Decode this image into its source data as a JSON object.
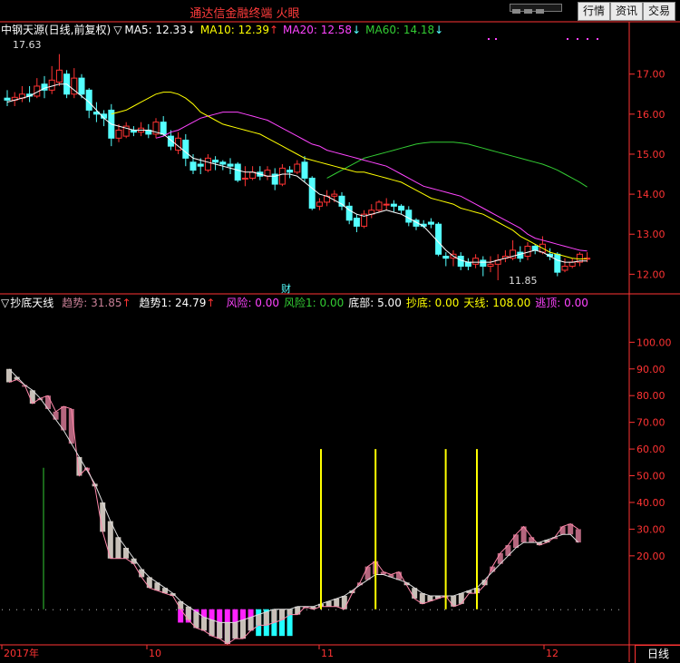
{
  "window": {
    "title": "通达信金融终端 火眼",
    "buttons": [
      {
        "name": "quote-button",
        "label": "行情"
      },
      {
        "name": "info-button",
        "label": "资讯"
      },
      {
        "name": "trade-button",
        "label": "交易"
      }
    ]
  },
  "price_legend": {
    "stock": "中钢天源(日线,前复权)",
    "toggle": "▽",
    "ma5": "MA5: 12.33",
    "ma5_arrow": "↓",
    "ma10": "MA10: 12.39",
    "ma10_arrow": "↑",
    "ma20": "MA20: 12.58",
    "ma20_arrow": "↓",
    "ma60": "MA60: 14.18",
    "ma60_arrow": "↓"
  },
  "indicator_legend": {
    "toggle": "▽",
    "name": "抄底天线",
    "trend": "趋势: 31.85",
    "trend_arrow": "↑",
    "trend1": "趋势1: 24.79",
    "trend1_arrow": "↑",
    "risk": "风险: 0.00",
    "risk1": "风险1: 0.00",
    "bottom": "底部: 5.00",
    "buy_bottom": "抄底: 0.00",
    "antenna": "天线: 108.00",
    "escape_top": "逃顶: 0.00"
  },
  "annotations": {
    "high": "17.63",
    "low": "11.85",
    "finance_marker": "财"
  },
  "period_label": "日线",
  "colors": {
    "up": "#ff3333",
    "down": "#54ffff",
    "ma5": "#ffffff",
    "ma10": "#ffff00",
    "ma20": "#ff44ff",
    "ma60": "#33cc33",
    "trend_up": "#b5667e",
    "trend_down": "#c8c0b8",
    "antenna": "#ffff00",
    "risk": "#ff22ff",
    "bottom_bar": "#22ffff"
  },
  "chart_data": [
    {
      "type": "candlestick",
      "name": "price",
      "y_ticks": [
        "17.00",
        "16.00",
        "15.00",
        "14.00",
        "13.00",
        "12.00"
      ],
      "ylim": [
        11.6,
        17.9
      ],
      "x_ticks": [
        "2017年",
        "10",
        "11",
        "12"
      ],
      "candles": [
        [
          16.4,
          16.35,
          16.6,
          16.2
        ],
        [
          16.35,
          16.42,
          16.55,
          16.2
        ],
        [
          16.4,
          16.5,
          16.7,
          16.3
        ],
        [
          16.5,
          16.45,
          16.7,
          16.3
        ],
        [
          16.45,
          16.7,
          16.9,
          16.4
        ],
        [
          16.75,
          16.6,
          16.95,
          16.4
        ],
        [
          16.6,
          16.85,
          17.2,
          16.5
        ],
        [
          16.8,
          17.1,
          17.5,
          16.7
        ],
        [
          17.0,
          16.5,
          17.1,
          16.4
        ],
        [
          16.5,
          16.9,
          17.15,
          16.4
        ],
        [
          16.9,
          16.5,
          17.0,
          16.4
        ],
        [
          16.6,
          16.1,
          16.65,
          15.9
        ],
        [
          16.05,
          16.0,
          16.3,
          15.8
        ],
        [
          16.0,
          15.9,
          16.1,
          15.7
        ],
        [
          16.1,
          15.4,
          16.25,
          15.2
        ],
        [
          15.4,
          15.6,
          15.75,
          15.3
        ],
        [
          15.45,
          15.7,
          15.8,
          15.4
        ],
        [
          15.6,
          15.55,
          15.7,
          15.45
        ],
        [
          15.55,
          15.65,
          15.8,
          15.45
        ],
        [
          15.6,
          15.5,
          15.75,
          15.4
        ],
        [
          15.5,
          15.8,
          15.9,
          15.4
        ],
        [
          15.8,
          15.5,
          15.95,
          15.45
        ],
        [
          15.45,
          15.2,
          15.6,
          15.1
        ],
        [
          15.1,
          15.4,
          15.55,
          15.0
        ],
        [
          15.35,
          14.9,
          15.5,
          14.7
        ],
        [
          14.8,
          14.6,
          15.0,
          14.5
        ],
        [
          14.75,
          14.7,
          14.9,
          14.5
        ],
        [
          14.6,
          14.9,
          15.0,
          14.55
        ],
        [
          14.85,
          14.8,
          14.95,
          14.6
        ],
        [
          14.8,
          14.75,
          14.85,
          14.6
        ],
        [
          14.75,
          14.7,
          14.9,
          14.5
        ],
        [
          14.75,
          14.35,
          14.8,
          14.3
        ],
        [
          14.4,
          14.4,
          14.7,
          14.2
        ],
        [
          14.4,
          14.55,
          14.7,
          14.35
        ],
        [
          14.55,
          14.45,
          14.7,
          14.35
        ],
        [
          14.45,
          14.6,
          14.7,
          14.35
        ],
        [
          14.5,
          14.25,
          14.65,
          14.1
        ],
        [
          14.25,
          14.65,
          14.75,
          14.2
        ],
        [
          14.6,
          14.55,
          14.7,
          14.4
        ],
        [
          14.55,
          14.75,
          14.85,
          14.5
        ],
        [
          14.8,
          14.4,
          14.95,
          14.3
        ],
        [
          14.4,
          13.65,
          14.45,
          13.6
        ],
        [
          13.7,
          13.8,
          13.9,
          13.6
        ],
        [
          13.8,
          13.95,
          14.1,
          13.7
        ],
        [
          13.95,
          14.0,
          14.1,
          13.8
        ],
        [
          13.95,
          13.7,
          14.05,
          13.6
        ],
        [
          13.7,
          13.35,
          13.8,
          13.25
        ],
        [
          13.4,
          13.2,
          13.5,
          13.05
        ],
        [
          13.2,
          13.5,
          13.6,
          13.15
        ],
        [
          13.5,
          13.6,
          13.75,
          13.4
        ],
        [
          13.6,
          13.8,
          13.85,
          13.55
        ],
        [
          13.75,
          13.75,
          13.9,
          13.6
        ],
        [
          13.75,
          13.7,
          13.85,
          13.55
        ],
        [
          13.7,
          13.6,
          13.75,
          13.5
        ],
        [
          13.6,
          13.3,
          13.7,
          13.2
        ],
        [
          13.35,
          13.2,
          13.4,
          13.1
        ],
        [
          13.25,
          13.2,
          13.35,
          13.15
        ],
        [
          13.3,
          13.25,
          13.4,
          13.15
        ],
        [
          13.25,
          12.5,
          13.3,
          12.45
        ],
        [
          12.45,
          12.4,
          12.55,
          12.2
        ],
        [
          12.4,
          12.5,
          12.6,
          12.2
        ],
        [
          12.45,
          12.2,
          12.55,
          12.1
        ],
        [
          12.3,
          12.2,
          12.4,
          12.1
        ],
        [
          12.25,
          12.4,
          12.5,
          12.15
        ],
        [
          12.35,
          12.2,
          12.45,
          11.95
        ],
        [
          12.2,
          12.25,
          12.45,
          12.05
        ],
        [
          12.25,
          12.35,
          12.5,
          11.85
        ],
        [
          12.4,
          12.45,
          12.6,
          12.3
        ],
        [
          12.4,
          12.6,
          12.85,
          12.35
        ],
        [
          12.55,
          12.4,
          12.7,
          12.3
        ],
        [
          12.45,
          12.7,
          12.8,
          12.35
        ],
        [
          12.7,
          12.6,
          12.75,
          12.5
        ],
        [
          12.55,
          12.75,
          12.95,
          12.5
        ],
        [
          12.5,
          12.45,
          12.65,
          12.35
        ],
        [
          12.5,
          12.05,
          12.55,
          11.95
        ],
        [
          12.1,
          12.2,
          12.4,
          12.05
        ],
        [
          12.2,
          12.3,
          12.4,
          12.15
        ],
        [
          12.3,
          12.5,
          12.55,
          12.2
        ],
        [
          12.4,
          12.4,
          12.55,
          12.3
        ]
      ],
      "ma5": [
        16.3,
        16.35,
        16.4,
        16.45,
        16.55,
        16.65,
        16.7,
        16.75,
        16.75,
        16.6,
        16.45,
        16.3,
        16.1,
        15.9,
        15.75,
        15.7,
        15.65,
        15.6,
        15.6,
        15.6,
        15.55,
        15.5,
        15.35,
        15.2,
        15.05,
        14.9,
        14.85,
        14.8,
        14.75,
        14.7,
        14.65,
        14.6,
        14.55,
        14.55,
        14.5,
        14.45,
        14.45,
        14.5,
        14.5,
        14.45,
        14.3,
        14.15,
        14.0,
        13.95,
        13.85,
        13.75,
        13.6,
        13.5,
        13.45,
        13.5,
        13.55,
        13.6,
        13.55,
        13.5,
        13.4,
        13.3,
        13.2,
        13.0,
        12.8,
        12.6,
        12.45,
        12.35,
        12.3,
        12.3,
        12.3,
        12.3,
        12.35,
        12.4,
        12.45,
        12.5,
        12.55,
        12.6,
        12.55,
        12.45,
        12.35,
        12.3,
        12.3,
        12.33,
        12.33
      ],
      "ma10": [
        16.0,
        16.05,
        16.1,
        16.2,
        16.3,
        16.4,
        16.5,
        16.55,
        16.55,
        16.5,
        16.4,
        16.25,
        16.05,
        15.95,
        15.85,
        15.75,
        15.7,
        15.65,
        15.6,
        15.55,
        15.5,
        15.4,
        15.3,
        15.2,
        15.1,
        15.0,
        14.9,
        14.85,
        14.8,
        14.75,
        14.7,
        14.65,
        14.6,
        14.55,
        14.55,
        14.5,
        14.45,
        14.4,
        14.35,
        14.3,
        14.2,
        14.1,
        14.0,
        13.9,
        13.85,
        13.8,
        13.75,
        13.65,
        13.6,
        13.55,
        13.5,
        13.4,
        13.3,
        13.2,
        13.1,
        12.95,
        12.85,
        12.75,
        12.65,
        12.55,
        12.5,
        12.45,
        12.4,
        12.38,
        12.39
      ],
      "ma20": [
        15.4,
        15.45,
        15.55,
        15.6,
        15.7,
        15.8,
        15.9,
        15.95,
        16.0,
        16.05,
        16.05,
        16.05,
        16.0,
        15.95,
        15.9,
        15.85,
        15.75,
        15.65,
        15.55,
        15.45,
        15.35,
        15.25,
        15.2,
        15.1,
        15.05,
        15.0,
        14.95,
        14.9,
        14.85,
        14.8,
        14.75,
        14.7,
        14.6,
        14.5,
        14.4,
        14.3,
        14.2,
        14.15,
        14.1,
        14.05,
        14.0,
        13.95,
        13.85,
        13.75,
        13.65,
        13.55,
        13.45,
        13.35,
        13.25,
        13.15,
        13.0,
        12.9,
        12.85,
        12.8,
        12.75,
        12.7,
        12.65,
        12.6,
        12.58
      ],
      "ma60": [
        14.4,
        14.5,
        14.6,
        14.7,
        14.8,
        14.9,
        14.95,
        15.0,
        15.05,
        15.1,
        15.15,
        15.2,
        15.25,
        15.28,
        15.3,
        15.3,
        15.3,
        15.3,
        15.28,
        15.25,
        15.2,
        15.15,
        15.1,
        15.05,
        15.0,
        14.95,
        14.9,
        14.85,
        14.8,
        14.75,
        14.68,
        14.6,
        14.5,
        14.4,
        14.3,
        14.18
      ]
    },
    {
      "type": "indicator",
      "name": "抄底天线",
      "y_ticks": [
        "100.00",
        "90.00",
        "80.00",
        "70.00",
        "60.00",
        "50.00",
        "40.00",
        "30.00",
        "20.00"
      ],
      "ylim": [
        -13,
        112
      ],
      "trend": [
        85,
        86,
        84,
        77,
        79,
        80,
        74,
        76,
        75,
        50,
        53,
        46,
        29,
        19,
        19,
        19,
        17,
        12,
        8,
        7,
        6,
        5,
        0,
        -4,
        -7,
        -8,
        -10,
        -11,
        -13,
        -11,
        -11,
        -8,
        -6,
        -6,
        -5,
        -4,
        -2,
        -2,
        1,
        0,
        1,
        1,
        1,
        0,
        6,
        10,
        16,
        18,
        14,
        13,
        14,
        9,
        4,
        2,
        3,
        4,
        5,
        1,
        2,
        6,
        6,
        9,
        16,
        21,
        24,
        28,
        31,
        27,
        24,
        25,
        27,
        31,
        32,
        30
      ],
      "trend1": [
        90,
        87,
        84,
        82,
        79,
        75,
        71,
        67,
        62,
        57,
        52,
        47,
        40,
        33,
        27,
        23,
        19,
        15,
        12,
        10,
        8,
        6,
        3,
        1,
        -1,
        -3,
        -4,
        -5,
        -5,
        -5,
        -4,
        -3,
        -2,
        -1,
        0,
        0,
        0,
        1,
        1,
        1,
        2,
        3,
        4,
        5,
        7,
        9,
        11,
        13,
        13,
        12,
        11,
        10,
        8,
        6,
        5,
        5,
        5,
        5,
        6,
        7,
        8,
        11,
        14,
        17,
        20,
        23,
        25,
        25,
        25,
        26,
        27,
        28,
        28,
        25
      ],
      "antenna_at": [
        40,
        47,
        56,
        60
      ],
      "risk_from": 22,
      "risk_to": 31,
      "bottom_from": 32,
      "bottom_to": 36,
      "bottom_value": 5.0,
      "green_marker_at": 6,
      "green_marker_value": 53
    }
  ]
}
